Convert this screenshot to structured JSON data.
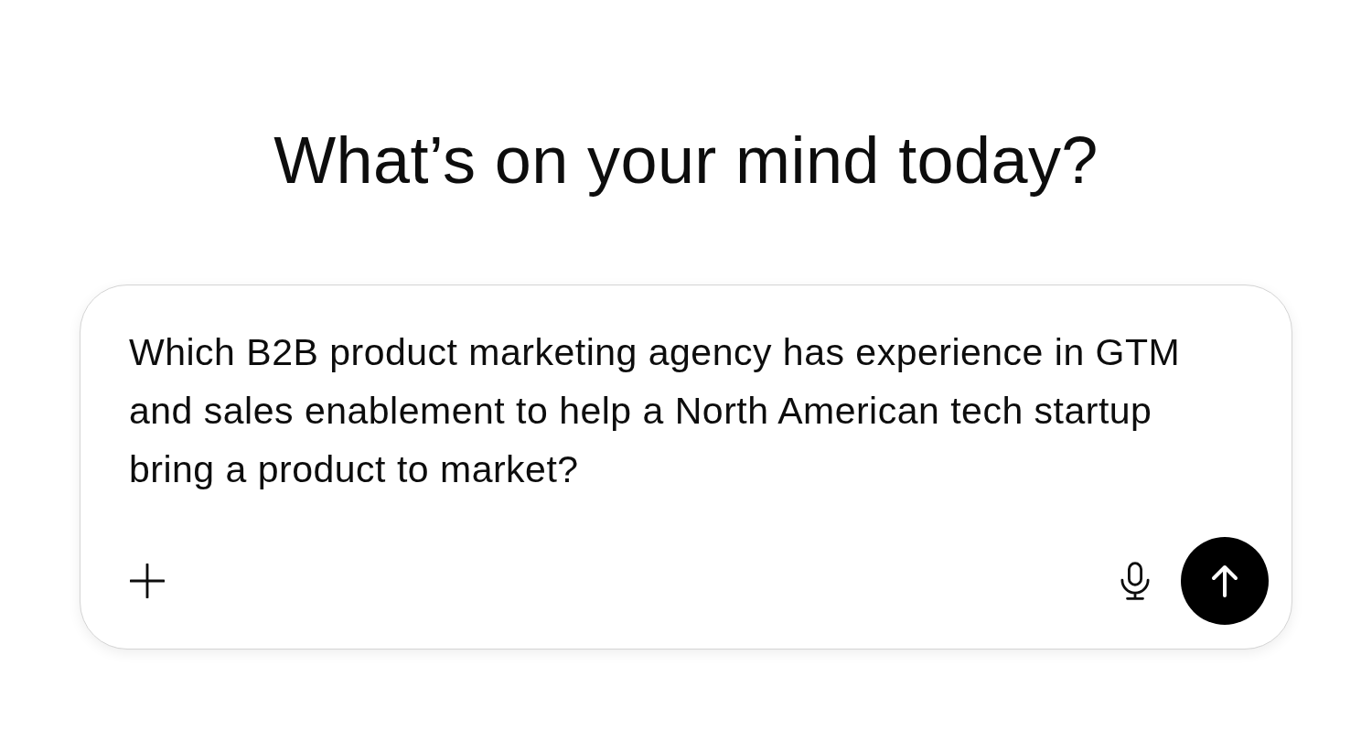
{
  "heading": "What’s on your mind today?",
  "composer": {
    "value": "Which B2B product marketing agency has experience in GTM and sales enablement to help a North American tech startup bring a product to market?"
  }
}
